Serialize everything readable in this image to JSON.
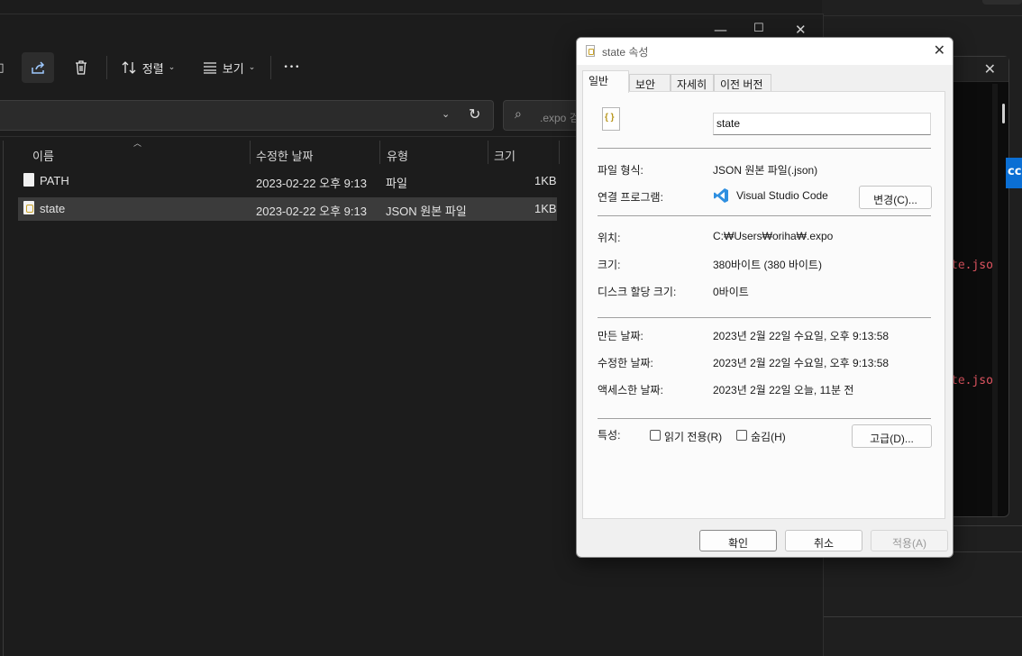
{
  "explorer": {
    "toolbar": {
      "sort_label": "정렬",
      "view_label": "보기",
      "more_label": "•••"
    },
    "search": {
      "placeholder": ".expo 검색"
    },
    "columns": {
      "name": "이름",
      "modified": "수정한 날짜",
      "type": "유형",
      "size": "크기"
    },
    "files": [
      {
        "name": "PATH",
        "modified": "2023-02-22 오후 9:13",
        "type": "파일",
        "size": "1KB",
        "selected": false
      },
      {
        "name": "state",
        "modified": "2023-02-22 오후 9:13",
        "type": "JSON 원본 파일",
        "size": "1KB",
        "selected": true
      }
    ]
  },
  "terminal": {
    "snippet_1": "te.jso",
    "snippet_2": "te.jso",
    "button_text": "cc"
  },
  "dialog": {
    "title": "state 속성",
    "tabs": [
      "일반",
      "보안",
      "자세히",
      "이전 버전"
    ],
    "file_name": "state",
    "file_type_label": "파일 형식:",
    "file_type_value": "JSON 원본 파일(.json)",
    "opens_with_label": "연결 프로그램:",
    "opens_with_value": "Visual Studio Code",
    "change_button": "변경(C)...",
    "location_label": "위치:",
    "location_value": "C:₩Users₩oriha₩.expo",
    "size_label": "크기:",
    "size_value": "380바이트 (380 바이트)",
    "size_on_disk_label": "디스크 할당 크기:",
    "size_on_disk_value": "0바이트",
    "created_label": "만든 날짜:",
    "created_value": "2023년 2월 22일 수요일, 오후 9:13:58",
    "modified_label": "수정한 날짜:",
    "modified_value": "2023년 2월 22일 수요일, 오후 9:13:58",
    "accessed_label": "액세스한 날짜:",
    "accessed_value": "2023년 2월 22일 오늘, 11분 전",
    "attributes_label": "특성:",
    "readonly_label": "읽기 전용(R)",
    "hidden_label": "숨김(H)",
    "advanced_button": "고급(D)...",
    "ok_button": "확인",
    "cancel_button": "취소",
    "apply_button": "적용(A)"
  },
  "colors": {
    "vscode_blue": "#2f8fe0",
    "selection": "#3b3b3b",
    "terminal_red": "#e05561"
  }
}
